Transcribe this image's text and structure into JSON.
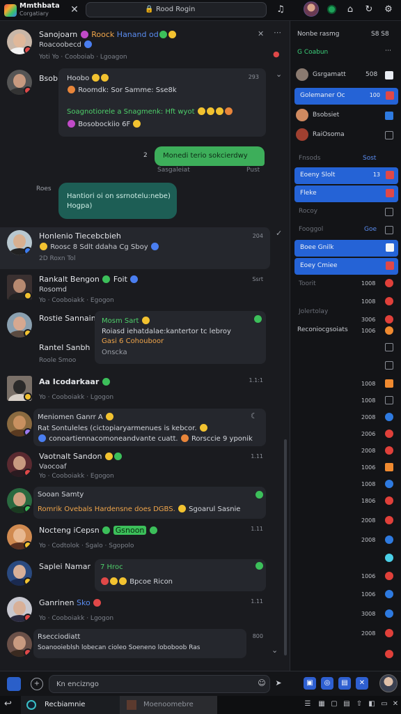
{
  "app": {
    "name": "Mmthbata",
    "subtitle": "Corgatiary"
  },
  "search": {
    "label": "Rood Rogin"
  },
  "chat": {
    "header": {
      "name": "Sanojoarn",
      "tag": "Roock",
      "tag2": "Hanand od",
      "status": "Roacoobecd",
      "meta": "Yoti Yo · Cooboiab · Lgoagon"
    },
    "msg1": {
      "sender": "Bsob",
      "time": "293",
      "l1": "Hoobo",
      "l2": "Roomdk: Sor Samme: Sse8k",
      "l3": "Soagnotiorele a Snagmenk: Hft wyot",
      "l4": "Bosobockiio 6F"
    },
    "outgoing": {
      "text": "Monedi terio sokcierdwy",
      "left_label": "Sasgaleiat",
      "right_label": "Pust",
      "mark": "2"
    },
    "teal_label": "Roes",
    "teal": {
      "l1": "Hantiori oi on ssrnotelu:nebe)",
      "l2": "Hogpa)"
    },
    "rows": [
      {
        "name": "Honlenio Tiecebcbieh",
        "line": "Roosc 8 Sdlt ddaha Cg Sboy",
        "meta": "2D Roxn Tol",
        "time": "204"
      },
      {
        "name": "Rankalt Bengon",
        "extra": "Foit",
        "line": "Rosomd",
        "meta": "Yo · Cooboiakk · Egogon",
        "time": "Ssrt"
      },
      {
        "name": "Rostie Sannain",
        "line": "Rantel Sanbh",
        "meta": "Roole Smoo",
        "bubble1": "Mosm Sart",
        "bubble2": "Roiasd iehatdalae:kantertor tc lebroy",
        "bubble3": "Gasi 6 Cohouboor",
        "bubble4": "Onscka",
        "time": ""
      },
      {
        "name": "Aa Icodarkaar",
        "meta": "Yo · Cooboiakk · Lgogon",
        "time": "1.1:1"
      },
      {
        "name": "Meniomen Ganrr A",
        "line": "Rat Sontuleles (cictopiaryarmenues is kebcor.",
        "line2": "conoartiennacomoneandvante cuatt.",
        "extra": "Rorsccie 9 yponik",
        "time": ""
      },
      {
        "name": "Vaotnalt Sandon",
        "line": "Vaocoaf",
        "meta": "Yo · Cooboiakk · Egogon",
        "time": "1.11"
      },
      {
        "name": "Sooan Samty",
        "line": "Romrik Ovebals Hardensne does DGBS.",
        "extra": "Sgoarul Sasnie",
        "time": ""
      },
      {
        "name": "Nocteng iCepsn",
        "tag": "Gsnoon",
        "meta": "Yo · Codtolok · Sgalo · Sgopolo",
        "time": "1.11"
      },
      {
        "name": "Saplei Namar",
        "tag": "7 Hroc",
        "extra": "Bpcoe Ricon",
        "time": ""
      },
      {
        "name": "Ganrinen",
        "tag": "Sko",
        "meta": "Yo · Cooboiakk · Lgogon",
        "time": "1.11"
      },
      {
        "name": "Rsecciodiatt",
        "line": "Soanooieblsh lobecan cioleo Soeneno loboboob Ras",
        "time": "800"
      }
    ]
  },
  "composer": {
    "placeholder": "Kn encizngo"
  },
  "taskbar": {
    "tab1": "Recbiamnie",
    "tab2": "Moenoomebre"
  },
  "sidebar": {
    "header": "Nonbe rasmg",
    "header_val": "S8 S8",
    "group": "G Coabun",
    "contact1": {
      "name": "Gsrgamatt",
      "val": "508"
    },
    "selected1": {
      "label": "Golemaner Oc",
      "val": "100"
    },
    "contact2": {
      "name": "Bsobsiet"
    },
    "contact3": {
      "name": "RaiOsoma"
    },
    "faint1": {
      "label": "Fnsods",
      "val": "Sost"
    },
    "selected2": {
      "label": "Eoeny Slolt",
      "val": "13"
    },
    "selected3": {
      "label": "Fleke"
    },
    "faint2": {
      "label": "Rocoy"
    },
    "faint3": {
      "label": "Fooggol",
      "val": "Goe"
    },
    "selected4": {
      "label": "Boee Gnilk"
    },
    "selected5": {
      "label": "Eoey Cmiee"
    },
    "faint4": {
      "label": "Toorit"
    },
    "faint5": {
      "label": "Jolertolay"
    },
    "section": "Reconiocgsoiats",
    "nums": [
      "1008",
      "1008",
      "3006",
      "1006",
      "1008",
      "1008",
      "2008",
      "2006",
      "2008",
      "1006",
      "1008",
      "1806",
      "2008",
      "2008",
      "1006",
      "1006",
      "3008",
      "2008"
    ]
  }
}
